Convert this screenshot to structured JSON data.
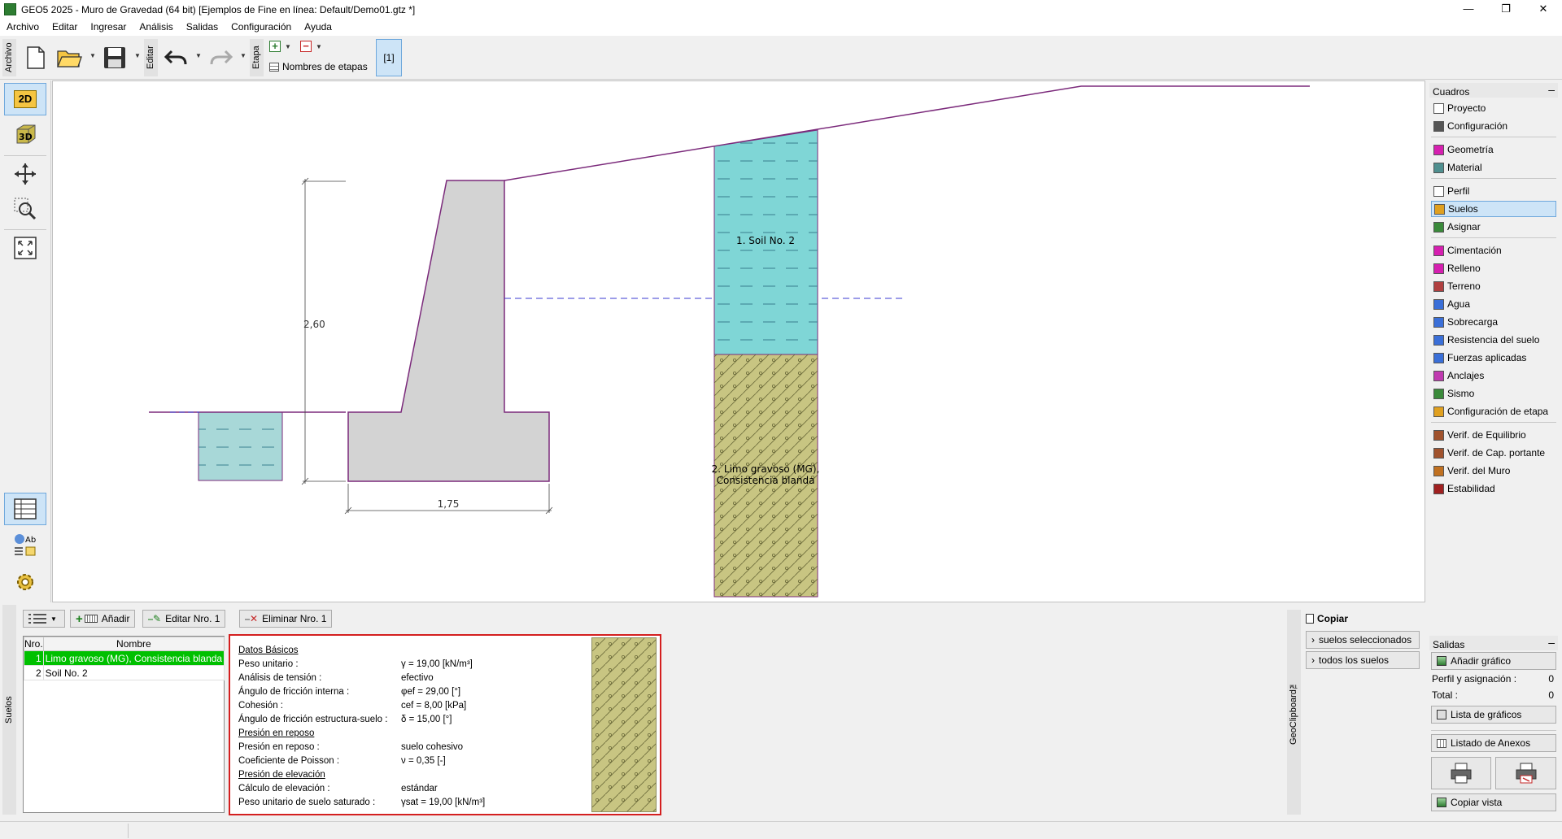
{
  "window": {
    "title": "GEO5 2025 - Muro de Gravedad (64 bit) [Ejemplos de Fine en línea: Default/Demo01.gtz *]",
    "minimize": "—",
    "restore": "❐",
    "close": "✕"
  },
  "menu": [
    "Archivo",
    "Editar",
    "Ingresar",
    "Análisis",
    "Salidas",
    "Configuración",
    "Ayuda"
  ],
  "toolbar": {
    "archivo_label": "Archivo",
    "editar_label": "Editar",
    "etapa_label": "Etapa",
    "stage_names_label": "Nombres de etapas",
    "stage_button": "[1]"
  },
  "lefttools": {
    "view_2d": "2D",
    "view_3d": "3D",
    "styles_label": "Ab"
  },
  "drawing": {
    "dim_height": "2,60",
    "dim_width": "1,75",
    "soil_upper": "1. Soil No. 2",
    "soil_lower_line1": "2. Limo gravoso (MG),",
    "soil_lower_line2": "Consistencia blanda",
    "colors": {
      "wall": "#d3d3d3",
      "outline": "#7b2a7b",
      "soil_upper": "#7fd6d6",
      "soil_lower": "#c8c582",
      "water": "#3a3ad0"
    }
  },
  "cuadros": {
    "header": "Cuadros",
    "minimize": "–",
    "groups": [
      [
        {
          "label": "Proyecto",
          "icon": "document-icon"
        },
        {
          "label": "Configuración",
          "icon": "gear-icon"
        }
      ],
      [
        {
          "label": "Geometría",
          "icon": "geometry-icon"
        },
        {
          "label": "Material",
          "icon": "material-icon"
        }
      ],
      [
        {
          "label": "Perfil",
          "icon": "profile-icon"
        },
        {
          "label": "Suelos",
          "icon": "soils-icon"
        },
        {
          "label": "Asignar",
          "icon": "assign-icon"
        }
      ],
      [
        {
          "label": "Cimentación",
          "icon": "foundation-icon"
        },
        {
          "label": "Relleno",
          "icon": "backfill-icon"
        },
        {
          "label": "Terreno",
          "icon": "terrain-icon"
        },
        {
          "label": "Agua",
          "icon": "water-icon"
        },
        {
          "label": "Sobrecarga",
          "icon": "surcharge-icon"
        },
        {
          "label": "Resistencia del suelo",
          "icon": "resistance-icon"
        },
        {
          "label": "Fuerzas aplicadas",
          "icon": "forces-icon"
        },
        {
          "label": "Anclajes",
          "icon": "anchor-icon"
        },
        {
          "label": "Sismo",
          "icon": "earthquake-icon"
        },
        {
          "label": "Configuración de etapa",
          "icon": "stage-settings-icon"
        }
      ],
      [
        {
          "label": "Verif. de Equilibrio",
          "icon": "equilibrium-icon"
        },
        {
          "label": "Verif. de Cap. portante",
          "icon": "bearing-icon"
        },
        {
          "label": "Verif. del Muro",
          "icon": "wall-check-icon"
        },
        {
          "label": "Estabilidad",
          "icon": "stability-icon"
        }
      ]
    ],
    "active": "Suelos"
  },
  "soils_panel": {
    "vertical_label": "Suelos",
    "add_button": "Añadir",
    "edit_button": "Editar Nro. 1",
    "delete_button": "Eliminar Nro. 1",
    "columns": [
      "Nro.",
      "Nombre"
    ],
    "rows": [
      {
        "no": "1",
        "name": "Limo gravoso (MG), Consistencia blanda"
      },
      {
        "no": "2",
        "name": "Soil No. 2"
      }
    ]
  },
  "details": {
    "sec_basic": "Datos Básicos",
    "rows_basic": [
      {
        "label": "Peso unitario :",
        "value": "γ = 19,00 [kN/m³]"
      },
      {
        "label": "Análisis de tensión :",
        "value": "efectivo"
      },
      {
        "label": "Ángulo de fricción interna :",
        "value": "φef = 29,00 [°]"
      },
      {
        "label": "Cohesión :",
        "value": "cef = 8,00 [kPa]"
      },
      {
        "label": "Ángulo de fricción estructura-suelo :",
        "value": "δ = 15,00 [°]"
      }
    ],
    "sec_rest": "Presión en reposo",
    "rows_rest": [
      {
        "label": "Presión en reposo :",
        "value": "suelo cohesivo"
      },
      {
        "label": "Coeficiente de Poisson :",
        "value": "ν = 0,35 [-]"
      }
    ],
    "sec_uplift": "Presión de elevación",
    "rows_uplift": [
      {
        "label": "Cálculo de elevación :",
        "value": "estándar"
      },
      {
        "label": "Peso unitario de suelo saturado :",
        "value": "γsat = 19,00 [kN/m³]"
      }
    ]
  },
  "clipboard": {
    "title": "Copiar",
    "btn_selected": "suelos seleccionados",
    "btn_all": "todos los suelos",
    "vertical_label": "GeoClipboard™"
  },
  "salidas": {
    "header": "Salidas",
    "minimize": "–",
    "add_graphic": "Añadir gráfico",
    "profile_label": "Perfil y asignación :",
    "profile_value": "0",
    "total_label": "Total :",
    "total_value": "0",
    "graphics_list": "Lista de gráficos",
    "annex_list": "Listado de Anexos",
    "copy_view": "Copiar vista"
  }
}
